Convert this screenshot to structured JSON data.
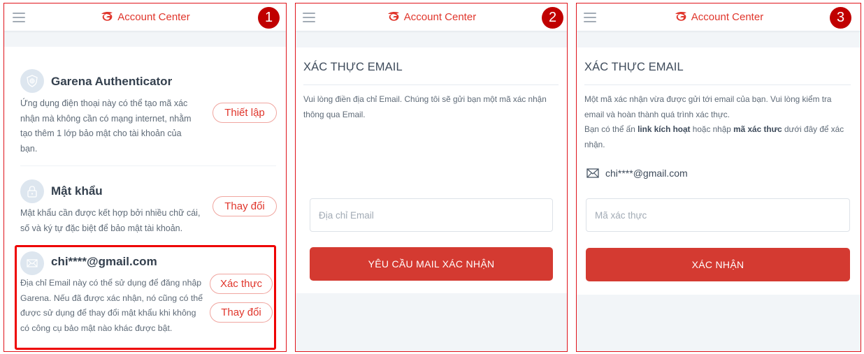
{
  "header": {
    "brand": "Account Center",
    "logo_icon": "garena-logo-icon",
    "menu_icon": "hamburger-menu-icon"
  },
  "colors": {
    "brand_red": "#e0352b",
    "button_red": "#d43a31",
    "badge_red": "#c00000",
    "highlight_red": "#ee0000",
    "page_gray": "#f2f5f8"
  },
  "steps": [
    "1",
    "2",
    "3"
  ],
  "panel1": {
    "items": [
      {
        "icon": "shield-icon",
        "title": "Garena Authenticator",
        "description": "Ứng dụng điện thoại này có thể tạo mã xác nhận mà không cần có mạng internet, nhằm tạo thêm 1 lớp bảo mật cho tài khoản của bạn.",
        "buttons": [
          "Thiết lập"
        ]
      },
      {
        "icon": "lock-icon",
        "title": "Mật khẩu",
        "description": "Mật khẩu cần được kết hợp bởi nhiều chữ cái, số và ký tự đặc biệt để bảo mật tài khoản.",
        "buttons": [
          "Thay đổi"
        ]
      },
      {
        "icon": "envelope-icon",
        "title": "chi****@gmail.com",
        "description": "Địa chỉ Email này có thể sử dụng để đăng nhập Garena. Nếu đã được xác nhận, nó cũng có thể được sử dụng để thay đổi mật khẩu khi không có công cụ bảo mật nào khác được bật.",
        "buttons": [
          "Xác thực",
          "Thay đổi"
        ]
      }
    ]
  },
  "panel2": {
    "title": "XÁC THỰC EMAIL",
    "description": "Vui lòng điền địa chỉ Email. Chúng tôi sẽ gửi bạn một mã xác nhận thông qua Email.",
    "email_input": {
      "value": "",
      "placeholder": "Địa chỉ Email"
    },
    "submit_label": "YÊU CẦU MAIL XÁC NHẬN"
  },
  "panel3": {
    "title": "XÁC THỰC EMAIL",
    "description_line1": "Một mã xác nhận vừa được gửi tới email của bạn. Vui lòng kiểm tra email và hoàn thành quá trình xác thực.",
    "description_line2_prefix": "Bạn có thể ấn ",
    "description_line2_bold1": "link kích hoạt",
    "description_line2_mid": " hoặc nhập ",
    "description_line2_bold2": "mã xác thưc",
    "description_line2_suffix": " dưới đây để xác nhận.",
    "email": "chi****@gmail.com",
    "code_input": {
      "value": "",
      "placeholder": "Mã xác thực"
    },
    "submit_label": "XÁC NHẬN"
  }
}
